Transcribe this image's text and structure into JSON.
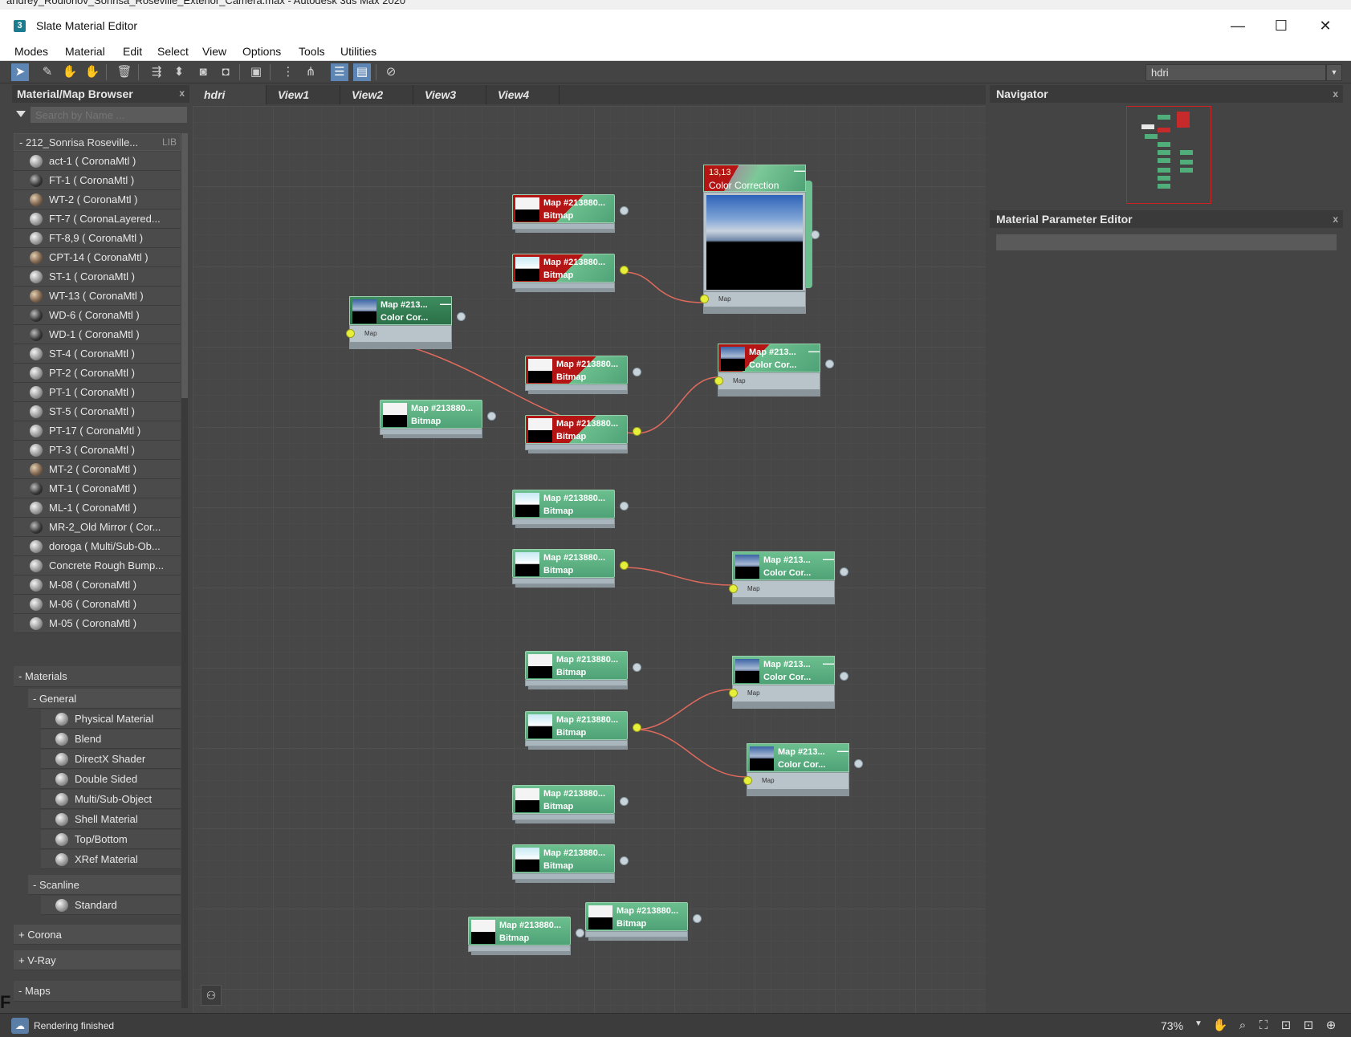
{
  "parent_window": {
    "title_fragment": "andrey_Rodionov_Sonrisa_Roseville_Exterior_Camera.max - Autodesk 3ds Max 2020"
  },
  "window": {
    "app_icon": "3",
    "title": "Slate Material Editor",
    "minimize": "—",
    "maximize": "☐",
    "close": "✕"
  },
  "menu": [
    "Modes",
    "Material",
    "Edit",
    "Select",
    "View",
    "Options",
    "Tools",
    "Utilities"
  ],
  "toolbar": {
    "view_select": "hdri",
    "view_select_arrow": "▼"
  },
  "browser": {
    "title": "Material/Map Browser",
    "close": "x",
    "search_placeholder": "Search by Name ...",
    "library": {
      "name": "- 212_Sonrisa Roseville...",
      "tag": "LIB"
    },
    "materials": [
      "act-1  ( CoronaMtl )",
      "FT-1  ( CoronaMtl )",
      "WT-2  ( CoronaMtl )",
      "FT-7  ( CoronaLayered...",
      "FT-8,9  ( CoronaMtl )",
      "CPT-14  ( CoronaMtl )",
      "ST-1  ( CoronaMtl )",
      "WT-13  ( CoronaMtl )",
      "WD-6  ( CoronaMtl )",
      "WD-1  ( CoronaMtl )",
      "ST-4  ( CoronaMtl )",
      "PT-2  ( CoronaMtl )",
      "PT-1  ( CoronaMtl )",
      "ST-5  ( CoronaMtl )",
      "PT-17  ( CoronaMtl )",
      "PT-3  ( CoronaMtl )",
      "MT-2  ( CoronaMtl )",
      "MT-1  ( CoronaMtl )",
      "ML-1  ( CoronaMtl )",
      "MR-2_Old Mirror  ( Cor...",
      "doroga  ( Multi/Sub-Ob...",
      "Concrete Rough Bump...",
      "M-08  ( CoronaMtl )",
      "M-06  ( CoronaMtl )",
      "M-05  ( CoronaMtl )"
    ],
    "materials_header": "- Materials",
    "general_header": "- General",
    "general_items": [
      "Physical Material",
      "Blend",
      "DirectX Shader",
      "Double Sided",
      "Multi/Sub-Object",
      "Shell Material",
      "Top/Bottom",
      "XRef Material"
    ],
    "scanline_header": "- Scanline",
    "scanline_items": [
      "Standard"
    ],
    "corona_header": "+ Corona",
    "vray_header": "+ V-Ray",
    "maps_header": "- Maps"
  },
  "tabs": [
    "hdri",
    "View1",
    "View2",
    "View3",
    "View4"
  ],
  "nodes": {
    "bitmap_title": "Map #213880...",
    "bitmap_sub": "Bitmap",
    "cc_title": "Map #213...",
    "cc_sub": "Color Cor...",
    "cc_left_title": "Map #213...",
    "slot_label": "Map",
    "minus": "—",
    "big": {
      "number": "13,13",
      "title": "Color Correction",
      "slot_label": "Map"
    }
  },
  "navigator": {
    "title": "Navigator",
    "close": "x"
  },
  "param_editor": {
    "title": "Material Parameter Editor",
    "close": "x"
  },
  "status": {
    "text": "Rendering finished",
    "zoom": "73%",
    "zoom_arrow": "▼"
  },
  "colors": {
    "node_green": "#4ea276",
    "wire": "#e06a5c",
    "socket_active": "#e6f03a",
    "selected_red": "#b41414"
  }
}
